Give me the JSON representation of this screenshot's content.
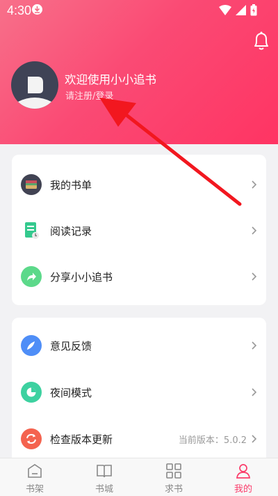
{
  "status_bar": {
    "time": "4:30"
  },
  "profile": {
    "welcome": "欢迎使用小小追书",
    "login_link": "请注册/登录"
  },
  "menu_group_1": [
    {
      "label": "我的书单",
      "icon": "bookshelf-icon"
    },
    {
      "label": "阅读记录",
      "icon": "reading-record-icon"
    },
    {
      "label": "分享小小追书",
      "icon": "share-icon"
    }
  ],
  "menu_group_2": [
    {
      "label": "意见反馈",
      "icon": "feedback-icon"
    },
    {
      "label": "夜间模式",
      "icon": "night-mode-icon"
    },
    {
      "label": "检查版本更新",
      "icon": "update-icon",
      "value": "当前版本：5.0.2"
    }
  ],
  "tabs": [
    {
      "label": "书架",
      "icon": "bookshelf-tab-icon"
    },
    {
      "label": "书城",
      "icon": "book-store-icon"
    },
    {
      "label": "求书",
      "icon": "request-book-icon"
    },
    {
      "label": "我的",
      "icon": "profile-icon",
      "active": true
    }
  ],
  "colors": {
    "accent": "#fa3c6a",
    "header_gradient_start": "#f8708a",
    "header_gradient_end": "#ff3463",
    "annotation_arrow": "#f2171f"
  }
}
